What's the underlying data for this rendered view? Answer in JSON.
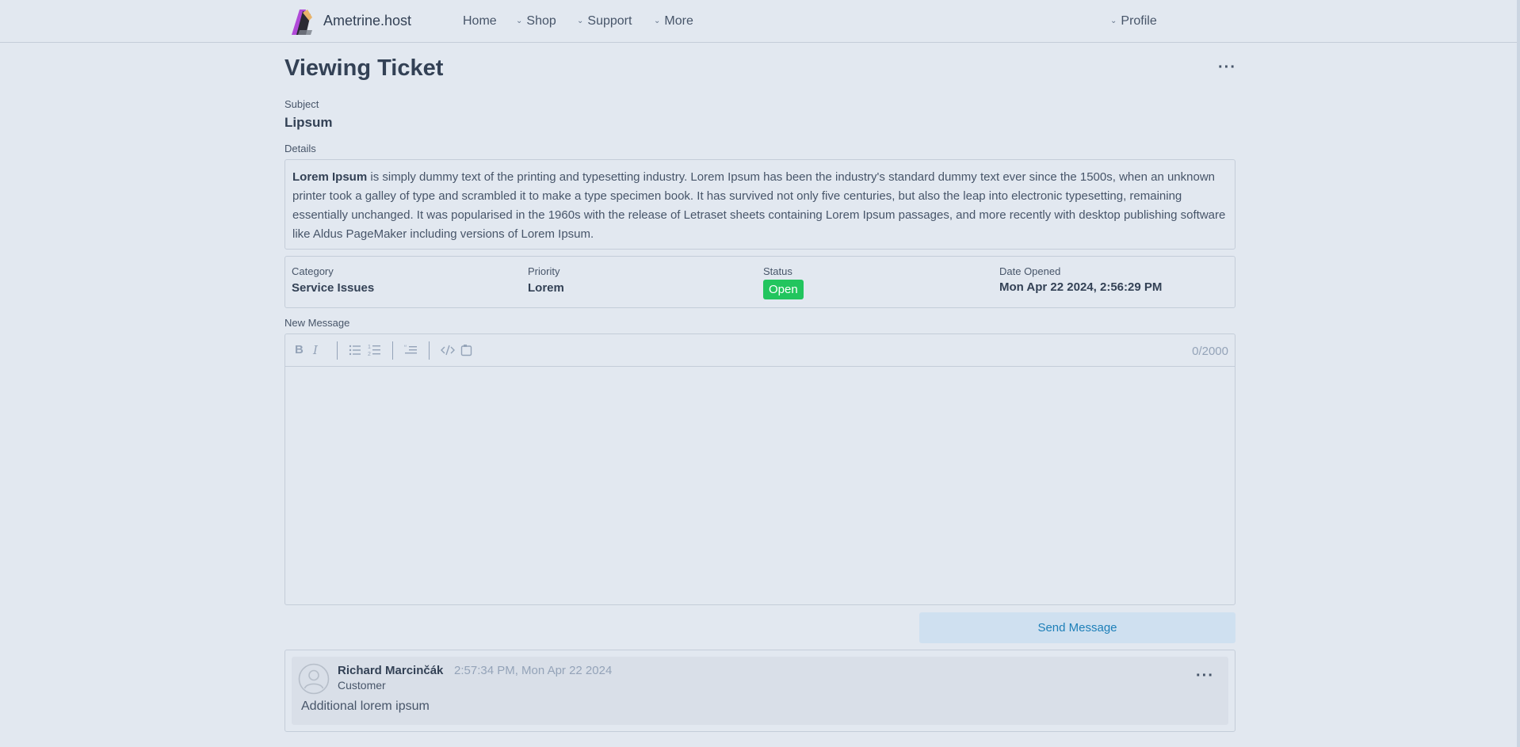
{
  "nav": {
    "brand": "Ametrine.host",
    "items": [
      {
        "label": "Home"
      },
      {
        "label": "Shop"
      },
      {
        "label": "Support"
      },
      {
        "label": "More"
      }
    ],
    "profile": "Profile"
  },
  "page": {
    "title": "Viewing Ticket"
  },
  "ticket": {
    "subject_label": "Subject",
    "subject": "Lipsum",
    "details_label": "Details",
    "details_bold": "Lorem Ipsum",
    "details_rest": " is simply dummy text of the printing and typesetting industry. Lorem Ipsum has been the industry's standard dummy text ever since the 1500s, when an unknown printer took a galley of type and scrambled it to make a type specimen book. It has survived not only five centuries, but also the leap into electronic typesetting, remaining essentially unchanged. It was popularised in the 1960s with the release of Letraset sheets containing Lorem Ipsum passages, and more recently with desktop publishing software like Aldus PageMaker including versions of Lorem Ipsum.",
    "category_label": "Category",
    "category": "Service Issues",
    "priority_label": "Priority",
    "priority": "Lorem",
    "status_label": "Status",
    "status": "Open",
    "status_color": "#22c55e",
    "date_label": "Date Opened",
    "date": "Mon Apr 22 2024, 2:56:29 PM"
  },
  "composer": {
    "label": "New Message",
    "counter": "0/2000",
    "send_label": "Send Message"
  },
  "messages": [
    {
      "author": "Richard Marcinčák",
      "timestamp": "2:57:34 PM, Mon Apr 22 2024",
      "role": "Customer",
      "body": "Additional lorem ipsum"
    }
  ]
}
